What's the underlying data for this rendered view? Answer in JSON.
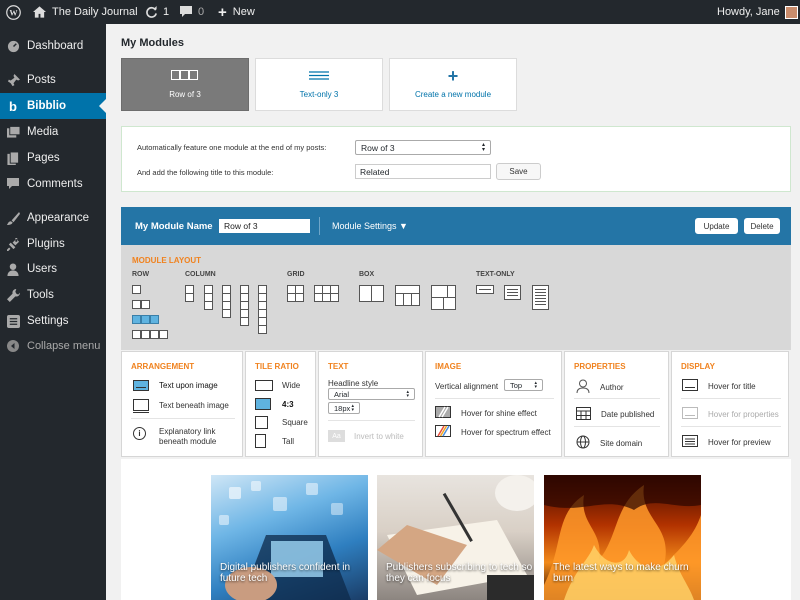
{
  "topbar": {
    "site_title": "The Daily Journal",
    "updates_count": "1",
    "comments_count": "0",
    "new_label": "New",
    "greeting": "Howdy, Jane"
  },
  "sidebar": {
    "items": [
      {
        "label": "Dashboard",
        "icon": "dashboard-icon"
      },
      {
        "label": "Posts",
        "icon": "pin-icon"
      },
      {
        "label": "Bibblio",
        "icon": "bibblio-icon",
        "active": true
      },
      {
        "label": "Media",
        "icon": "media-icon"
      },
      {
        "label": "Pages",
        "icon": "pages-icon"
      },
      {
        "label": "Comments",
        "icon": "comment-icon"
      },
      {
        "label": "Appearance",
        "icon": "brush-icon"
      },
      {
        "label": "Plugins",
        "icon": "plug-icon"
      },
      {
        "label": "Users",
        "icon": "user-icon"
      },
      {
        "label": "Tools",
        "icon": "wrench-icon"
      },
      {
        "label": "Settings",
        "icon": "settings-icon"
      },
      {
        "label": "Collapse menu",
        "icon": "collapse-icon"
      }
    ]
  },
  "page": {
    "title": "My Modules"
  },
  "modules": {
    "cards": [
      "Row of 3",
      "Text-only 3",
      "Create a new module"
    ]
  },
  "auto_feature": {
    "label1": "Automatically feature one module at the end of my posts:",
    "select_value": "Row of 3",
    "label2": "And add the following title to this module:",
    "title_value": "Related",
    "save_label": "Save"
  },
  "editor": {
    "name_label": "My Module Name",
    "name_value": "Row of 3",
    "settings_label": "Module Settings ▼",
    "update_label": "Update",
    "delete_label": "Delete"
  },
  "layout": {
    "title": "MODULE LAYOUT",
    "groups": [
      "ROW",
      "COLUMN",
      "GRID",
      "BOX",
      "TEXT-ONLY"
    ]
  },
  "arrangement": {
    "title": "ARRANGEMENT",
    "options": [
      "Text upon image",
      "Text beneath image",
      "Explanatory link beneath module"
    ]
  },
  "tile_ratio": {
    "title": "TILE RATIO",
    "options": [
      "Wide",
      "4:3",
      "Square",
      "Tall"
    ]
  },
  "text": {
    "title": "TEXT",
    "headline_label": "Headline style",
    "font_value": "Arial",
    "size_value": "18px",
    "invert_label": "Invert to white",
    "invert_btn": "Aa"
  },
  "image": {
    "title": "IMAGE",
    "valign_label": "Vertical alignment",
    "valign_value": "Top",
    "shine_label": "Hover for shine effect",
    "spectrum_label": "Hover for spectrum effect"
  },
  "properties": {
    "title": "PROPERTIES",
    "options": [
      "Author",
      "Date published",
      "Site domain"
    ]
  },
  "display": {
    "title": "DISPLAY",
    "options": [
      "Hover for title",
      "Hover for properties",
      "Hover for preview"
    ]
  },
  "preview": {
    "tiles": [
      "Digital publishers confident in future tech",
      "Publishers subscribing to tech so they can focus",
      "The latest ways to make churn burn"
    ]
  },
  "colors": {
    "accent": "#0073aa",
    "header": "#2475a6",
    "orange": "#f0821e",
    "admin_bar": "#23282d"
  }
}
